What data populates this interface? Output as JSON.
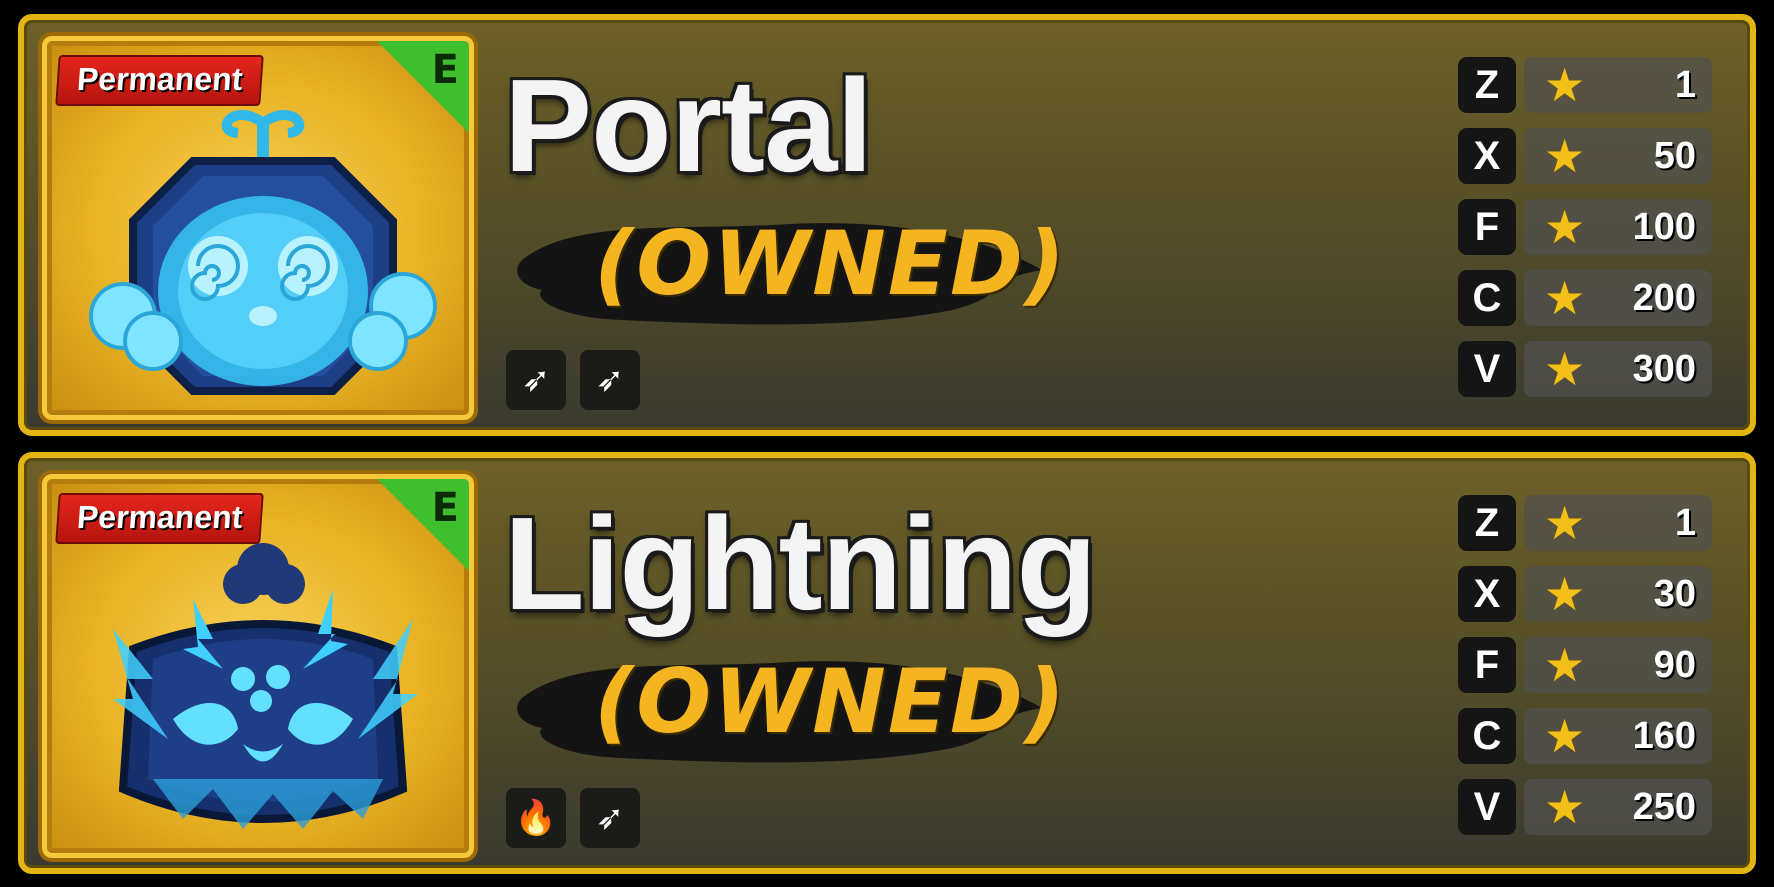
{
  "colors": {
    "frame": "#e2b414",
    "tag": "#e5261b",
    "rank": "#3fbf2e",
    "owned": "#f5b520",
    "star": "#f3c01a",
    "fruit": "#3fd0ff"
  },
  "fruits": [
    {
      "tag": "Permanent",
      "rank": "E",
      "name": "Portal",
      "status": "(OWNED)",
      "icon": "portal-fruit-icon",
      "abilities": [
        {
          "icon": "sword-icon",
          "glyph": "➶"
        },
        {
          "icon": "sword-icon",
          "glyph": "➶"
        }
      ],
      "moves": [
        {
          "key": "Z",
          "cost": "1"
        },
        {
          "key": "X",
          "cost": "50"
        },
        {
          "key": "F",
          "cost": "100"
        },
        {
          "key": "C",
          "cost": "200"
        },
        {
          "key": "V",
          "cost": "300"
        }
      ]
    },
    {
      "tag": "Permanent",
      "rank": "E",
      "name": "Lightning",
      "status": "(OWNED)",
      "icon": "lightning-fruit-icon",
      "abilities": [
        {
          "icon": "flame-icon",
          "glyph": "🔥"
        },
        {
          "icon": "sword-icon",
          "glyph": "➶"
        }
      ],
      "moves": [
        {
          "key": "Z",
          "cost": "1"
        },
        {
          "key": "X",
          "cost": "30"
        },
        {
          "key": "F",
          "cost": "90"
        },
        {
          "key": "C",
          "cost": "160"
        },
        {
          "key": "V",
          "cost": "250"
        }
      ]
    }
  ]
}
